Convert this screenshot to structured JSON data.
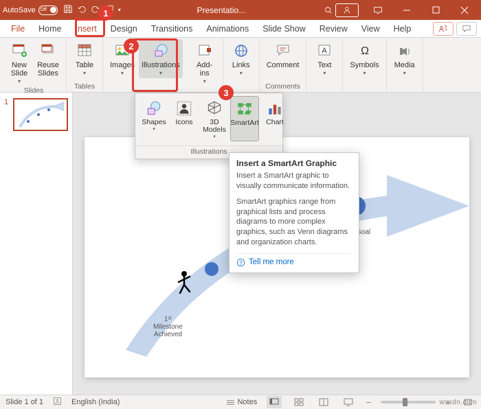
{
  "titlebar": {
    "autosave_label": "AutoSave",
    "autosave_state": "Off",
    "doc_title": "Presentatio..."
  },
  "tabs": {
    "file": "File",
    "home": "Home",
    "insert": "Insert",
    "design": "Design",
    "transitions": "Transitions",
    "animations": "Animations",
    "slideshow": "Slide Show",
    "review": "Review",
    "view": "View",
    "help": "Help"
  },
  "ribbon": {
    "new_slide": "New\nSlide",
    "reuse_slides": "Reuse\nSlides",
    "table": "Table",
    "images": "Images",
    "illustrations": "Illustrations",
    "addins": "Add-\nins",
    "links": "Links",
    "comment": "Comment",
    "text": "Text",
    "symbols": "Symbols",
    "media": "Media",
    "group_slides": "Slides",
    "group_tables": "Tables",
    "group_comments": "Comments"
  },
  "dropdown": {
    "shapes": "Shapes",
    "icons": "Icons",
    "models3d": "3D\nModels",
    "smartart": "SmartArt",
    "chart": "Chart",
    "group_label": "Illustrations"
  },
  "tooltip": {
    "title": "Insert a SmartArt Graphic",
    "p1": "Insert a SmartArt graphic to visually communicate information.",
    "p2": "SmartArt graphics range from graphical lists and process diagrams to more complex graphics, such as Venn diagrams and organization charts.",
    "tell_more": "Tell me more"
  },
  "slide": {
    "milestone1": "1ˢᵗ\nMilestone\nAchieved",
    "goal": "Goal"
  },
  "status": {
    "slide_of": "Slide 1 of 1",
    "lang": "English (India)",
    "notes": "Notes"
  },
  "watermark": "wsxdn.com",
  "thumb_num": "1"
}
